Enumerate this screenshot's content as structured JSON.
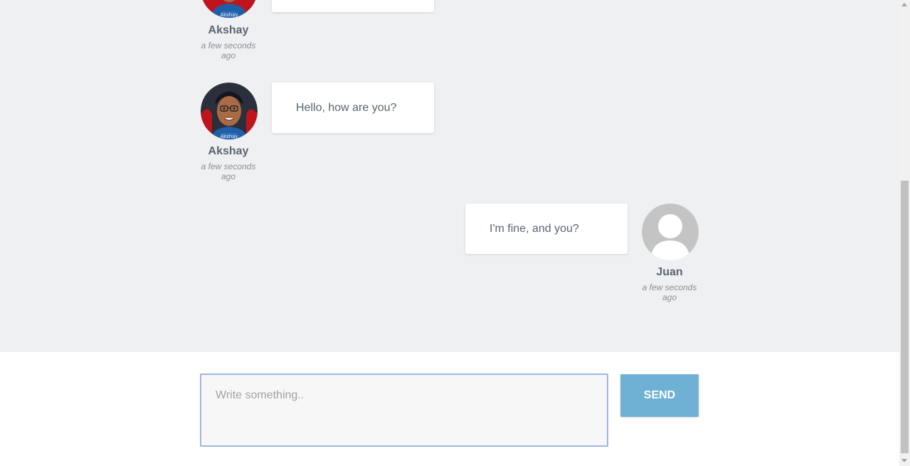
{
  "messages": [
    {
      "author": "Akshay",
      "time": "a few seconds ago",
      "text": "",
      "side": "left",
      "avatar": "akshay-avatar-icon"
    },
    {
      "author": "Akshay",
      "time": "a few seconds ago",
      "text": "Hello, how are you?",
      "side": "left",
      "avatar": "akshay-avatar-icon"
    },
    {
      "author": "Juan",
      "time": "a few seconds ago",
      "text": "I'm fine, and you?",
      "side": "right",
      "avatar": "default-user-avatar-icon"
    }
  ],
  "avatar_badge": "Akshay",
  "composer": {
    "placeholder": "Write something..",
    "value": "",
    "send_label": "SEND"
  },
  "colors": {
    "chat_background": "#eff0f2",
    "send_button": "#6fb1d5",
    "input_border": "#9db8de"
  }
}
